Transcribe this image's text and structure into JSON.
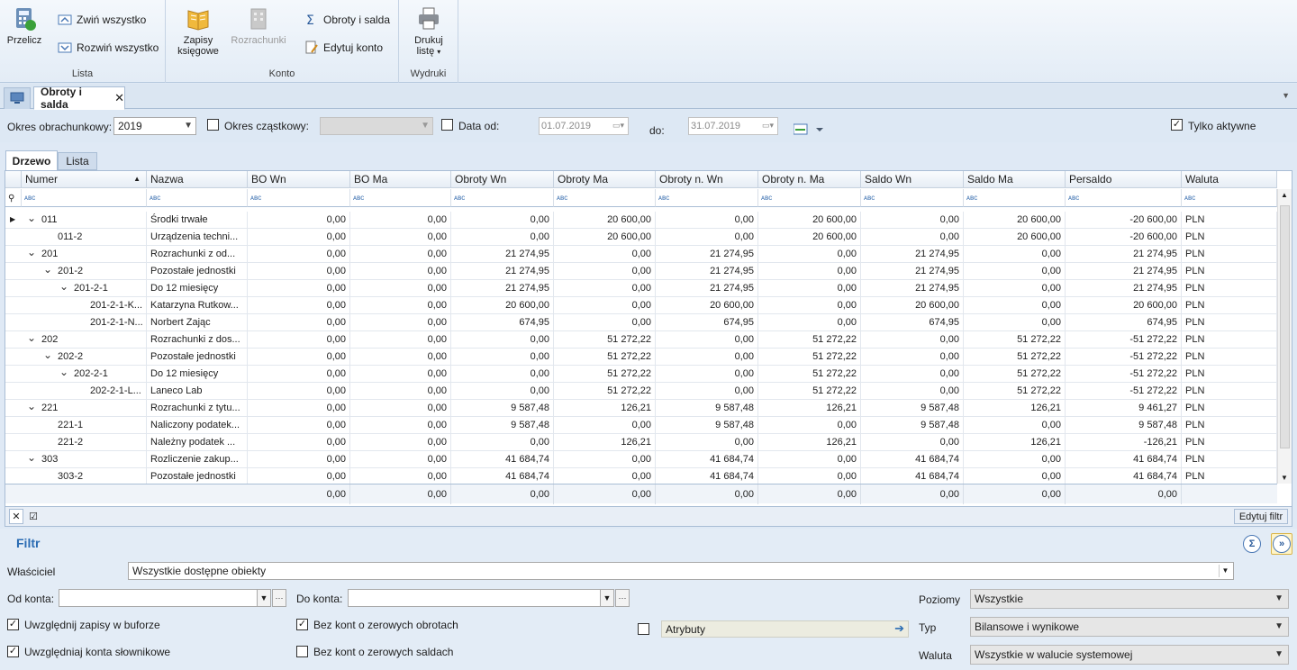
{
  "ribbon": {
    "przelicz": "Przelicz",
    "zwin": "Zwiń wszystko",
    "rozwin": "Rozwiń wszystko",
    "group_lista": "Lista",
    "zapisy_1": "Zapisy",
    "zapisy_2": "księgowe",
    "rozrachunki": "Rozrachunki",
    "obroty": "Obroty i salda",
    "edytuj": "Edytuj konto",
    "group_konto": "Konto",
    "drukuj_1": "Drukuj",
    "drukuj_2": "listę",
    "group_wydruki": "Wydruki"
  },
  "tabs": {
    "active": "Obroty i salda"
  },
  "filters": {
    "okres_label": "Okres obrachunkowy:",
    "okres_value": "2019",
    "czastkowy_label": "Okres cząstkowy:",
    "data_od_label": "Data od:",
    "data_od_value": "01.07.2019",
    "do_label": "do:",
    "do_value": "31.07.2019",
    "aktywne_label": "Tylko aktywne"
  },
  "subtabs": [
    "Drzewo",
    "Lista"
  ],
  "grid": {
    "columns": [
      "Numer",
      "Nazwa",
      "BO Wn",
      "BO Ma",
      "Obroty Wn",
      "Obroty Ma",
      "Obroty n. Wn",
      "Obroty n. Ma",
      "Saldo Wn",
      "Saldo Ma",
      "Persaldo",
      "Waluta"
    ],
    "filter_marker": "ᴀʙᴄ",
    "rows": [
      [
        "011",
        "Środki trwałe",
        "0,00",
        "0,00",
        "0,00",
        "20 600,00",
        "0,00",
        "20 600,00",
        "0,00",
        "20 600,00",
        "-20 600,00",
        "PLN"
      ],
      [
        "011-2",
        "Urządzenia techni...",
        "0,00",
        "0,00",
        "0,00",
        "20 600,00",
        "0,00",
        "20 600,00",
        "0,00",
        "20 600,00",
        "-20 600,00",
        "PLN"
      ],
      [
        "201",
        "Rozrachunki z od...",
        "0,00",
        "0,00",
        "21 274,95",
        "0,00",
        "21 274,95",
        "0,00",
        "21 274,95",
        "0,00",
        "21 274,95",
        "PLN"
      ],
      [
        "201-2",
        "Pozostałe jednostki",
        "0,00",
        "0,00",
        "21 274,95",
        "0,00",
        "21 274,95",
        "0,00",
        "21 274,95",
        "0,00",
        "21 274,95",
        "PLN"
      ],
      [
        "201-2-1",
        "Do 12 miesięcy",
        "0,00",
        "0,00",
        "21 274,95",
        "0,00",
        "21 274,95",
        "0,00",
        "21 274,95",
        "0,00",
        "21 274,95",
        "PLN"
      ],
      [
        "201-2-1-K...",
        "Katarzyna Rutkow...",
        "0,00",
        "0,00",
        "20 600,00",
        "0,00",
        "20 600,00",
        "0,00",
        "20 600,00",
        "0,00",
        "20 600,00",
        "PLN"
      ],
      [
        "201-2-1-N...",
        "Norbert Zając",
        "0,00",
        "0,00",
        "674,95",
        "0,00",
        "674,95",
        "0,00",
        "674,95",
        "0,00",
        "674,95",
        "PLN"
      ],
      [
        "202",
        "Rozrachunki z dos...",
        "0,00",
        "0,00",
        "0,00",
        "51 272,22",
        "0,00",
        "51 272,22",
        "0,00",
        "51 272,22",
        "-51 272,22",
        "PLN"
      ],
      [
        "202-2",
        "Pozostałe jednostki",
        "0,00",
        "0,00",
        "0,00",
        "51 272,22",
        "0,00",
        "51 272,22",
        "0,00",
        "51 272,22",
        "-51 272,22",
        "PLN"
      ],
      [
        "202-2-1",
        "Do 12 miesięcy",
        "0,00",
        "0,00",
        "0,00",
        "51 272,22",
        "0,00",
        "51 272,22",
        "0,00",
        "51 272,22",
        "-51 272,22",
        "PLN"
      ],
      [
        "202-2-1-L...",
        "Laneco Lab",
        "0,00",
        "0,00",
        "0,00",
        "51 272,22",
        "0,00",
        "51 272,22",
        "0,00",
        "51 272,22",
        "-51 272,22",
        "PLN"
      ],
      [
        "221",
        "Rozrachunki z tytu...",
        "0,00",
        "0,00",
        "9 587,48",
        "126,21",
        "9 587,48",
        "126,21",
        "9 587,48",
        "126,21",
        "9 461,27",
        "PLN"
      ],
      [
        "221-1",
        "Naliczony podatek...",
        "0,00",
        "0,00",
        "9 587,48",
        "0,00",
        "9 587,48",
        "0,00",
        "9 587,48",
        "0,00",
        "9 587,48",
        "PLN"
      ],
      [
        "221-2",
        "Należny podatek ...",
        "0,00",
        "0,00",
        "0,00",
        "126,21",
        "0,00",
        "126,21",
        "0,00",
        "126,21",
        "-126,21",
        "PLN"
      ],
      [
        "303",
        "Rozliczenie zakup...",
        "0,00",
        "0,00",
        "41 684,74",
        "0,00",
        "41 684,74",
        "0,00",
        "41 684,74",
        "0,00",
        "41 684,74",
        "PLN"
      ],
      [
        "303-2",
        "Pozostałe jednostki",
        "0,00",
        "0,00",
        "41 684,74",
        "0,00",
        "41 684,74",
        "0,00",
        "41 684,74",
        "0,00",
        "41 684,74",
        "PLN"
      ]
    ],
    "totals": [
      "0,00",
      "0,00",
      "0,00",
      "0,00",
      "0,00",
      "0,00",
      "0,00",
      "0,00",
      "0,00"
    ]
  },
  "gridfoot": {
    "edit_filter": "Edytuj filtr"
  },
  "panel": {
    "title": "Filtr",
    "wlasciciel_label": "Właściciel",
    "wlasciciel_value": "Wszystkie dostępne obiekty",
    "od_konta_label": "Od konta:",
    "do_konta_label": "Do konta:",
    "poziomy_label": "Poziomy",
    "poziomy_value": "Wszystkie",
    "typ_label": "Typ",
    "typ_value": "Bilansowe i wynikowe",
    "waluta_label": "Waluta",
    "waluta_value": "Wszystkie w walucie systemowej",
    "bufor_label": "Uwzględnij zapisy w buforze",
    "slownikowe_label": "Uwzględniaj konta słownikowe",
    "zerowe_obroty_label": "Bez kont o zerowych obrotach",
    "zerowe_salda_label": "Bez kont o zerowych saldach",
    "atrybuty_label": "Atrybuty"
  }
}
